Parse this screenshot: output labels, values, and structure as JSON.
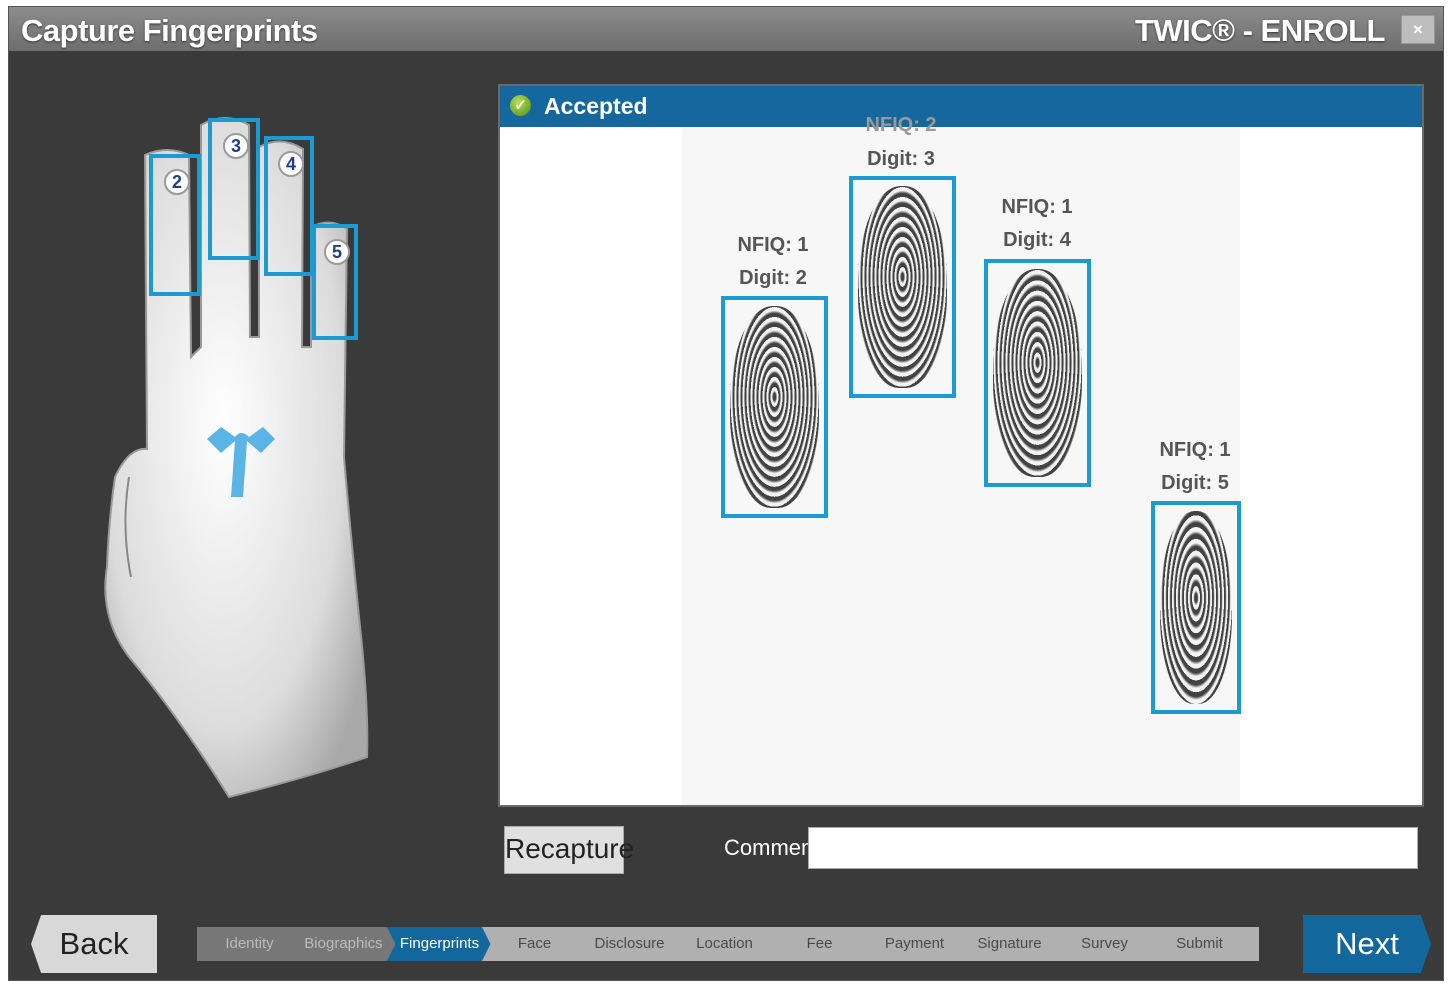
{
  "window": {
    "title": "Capture Fingerprints",
    "app_name": "TWIC® - ENROLL",
    "close_label": "×"
  },
  "hand": {
    "fingers": [
      "2",
      "3",
      "4",
      "5"
    ]
  },
  "capture_panel": {
    "status": "Accepted",
    "prints": [
      {
        "nfiq": "NFIQ: 1",
        "digit": "Digit: 2"
      },
      {
        "nfiq": "NFIQ: 2",
        "digit": "Digit: 3"
      },
      {
        "nfiq": "NFIQ: 1",
        "digit": "Digit: 4"
      },
      {
        "nfiq": "NFIQ: 1",
        "digit": "Digit: 5"
      }
    ]
  },
  "controls": {
    "recapture_label": "Recapture",
    "comment_label": "Comment:",
    "comment_value": ""
  },
  "nav": {
    "back_label": "Back",
    "next_label": "Next",
    "steps": [
      "Identity",
      "Biographics",
      "Fingerprints",
      "Face",
      "Disclosure",
      "Location",
      "Fee",
      "Payment",
      "Signature",
      "Survey",
      "Submit"
    ]
  },
  "colors": {
    "accent": "#12679d",
    "highlight": "#1b9bd1"
  }
}
